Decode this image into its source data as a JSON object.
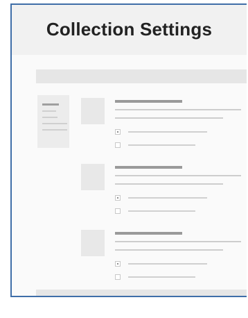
{
  "window": {
    "title": "Collection Settings"
  },
  "sidebar": {
    "items": [
      "",
      "",
      "",
      "",
      ""
    ]
  },
  "sections": [
    {
      "options": [
        {
          "checked": true
        },
        {
          "checked": false
        }
      ]
    },
    {
      "options": [
        {
          "checked": true
        },
        {
          "checked": false
        }
      ]
    },
    {
      "options": [
        {
          "checked": true
        },
        {
          "checked": false
        }
      ]
    }
  ],
  "colors": {
    "frame_border": "#3f6ea8",
    "header_background": "#f1f1f1",
    "placeholder_dark": "#9a9a9a",
    "placeholder_light": "#cdcdcd"
  }
}
